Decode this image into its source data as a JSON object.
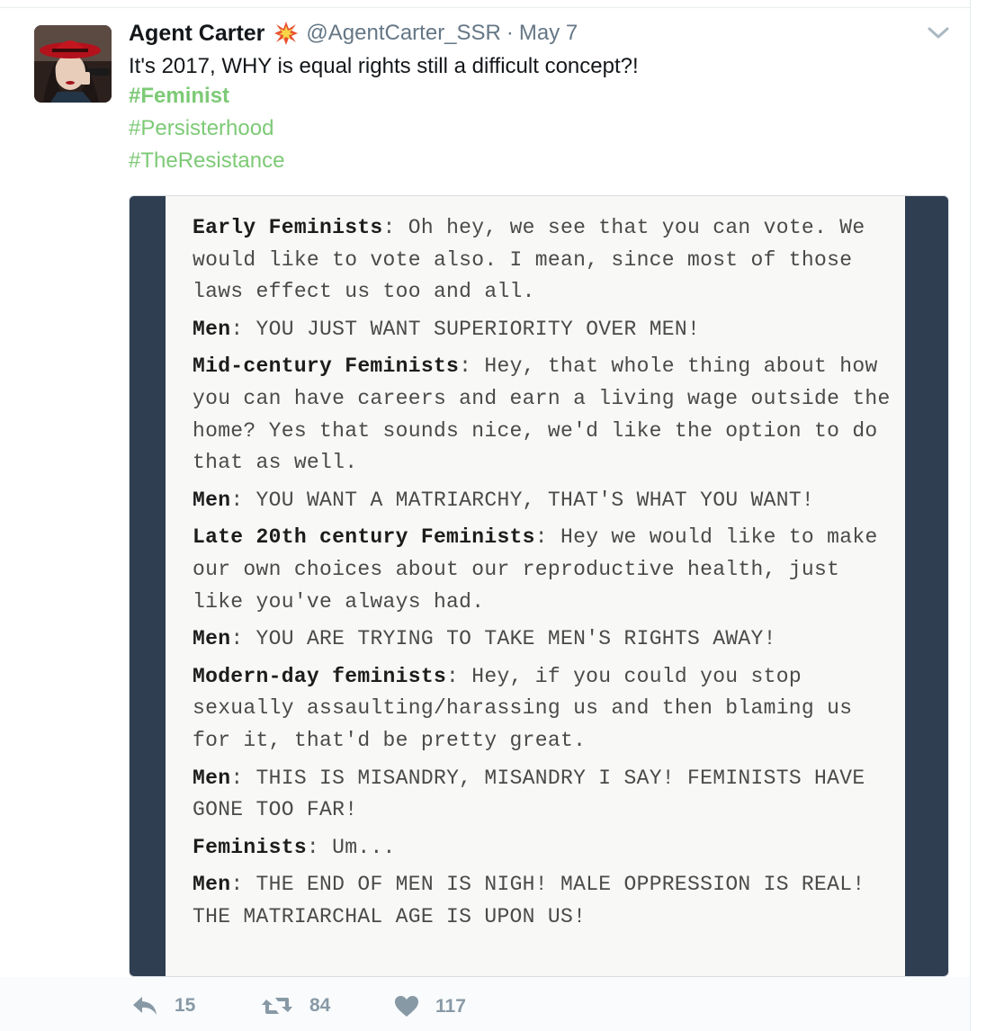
{
  "tweet": {
    "display_name": "Agent Carter",
    "handle": "@AgentCarter_SSR",
    "separator": "·",
    "date": "May 7",
    "text": "It's 2017, WHY is equal rights still a difficult concept?!",
    "hashtags": [
      "#Feminist",
      "#Persisterhood",
      "#TheResistance"
    ],
    "link_color": "#7dca76"
  },
  "image_text": {
    "paragraphs": [
      {
        "speaker": "Early Feminists",
        "sep": ": ",
        "text": "Oh hey, we see that you can vote. We would like to vote also. I mean, since most of those laws effect us too and all."
      },
      {
        "speaker": "Men",
        "sep": ": ",
        "text": "YOU JUST WANT SUPERIORITY OVER MEN!"
      },
      {
        "speaker": "Mid-century Feminists",
        "sep": ": ",
        "text": "Hey, that whole thing about how you can have careers and earn a living wage outside the home? Yes that sounds nice, we'd like the option to do that as well."
      },
      {
        "speaker": "Men",
        "sep": ": ",
        "text": "YOU WANT A MATRIARCHY, THAT'S WHAT YOU WANT!"
      },
      {
        "speaker": "Late 20th century Feminists",
        "sep": ": ",
        "text": "Hey we would like to make our own choices about our reproductive health, just like you've always had."
      },
      {
        "speaker": "Men",
        "sep": ": ",
        "text": "YOU ARE TRYING TO TAKE MEN'S RIGHTS AWAY!"
      },
      {
        "speaker": "Modern-day feminists",
        "sep": ": ",
        "text": "Hey, if you could you stop sexually assaulting/harassing us and then blaming us for it, that'd be pretty great."
      },
      {
        "speaker": "Men",
        "sep": ": ",
        "text": "THIS IS MISANDRY, MISANDRY I SAY! FEMINISTS HAVE GONE TOO FAR!"
      },
      {
        "speaker": "Feminists",
        "sep": ": ",
        "text": "Um..."
      },
      {
        "speaker": "Men",
        "sep": ": ",
        "text": "THE END OF MEN IS NIGH! MALE OPPRESSION IS REAL! THE MATRIARCHAL AGE IS UPON US!"
      }
    ]
  },
  "actions": {
    "reply_icon": "reply-icon",
    "reply_count": "15",
    "retweet_icon": "retweet-icon",
    "retweet_count": "84",
    "like_icon": "heart-icon",
    "like_count": "117"
  }
}
